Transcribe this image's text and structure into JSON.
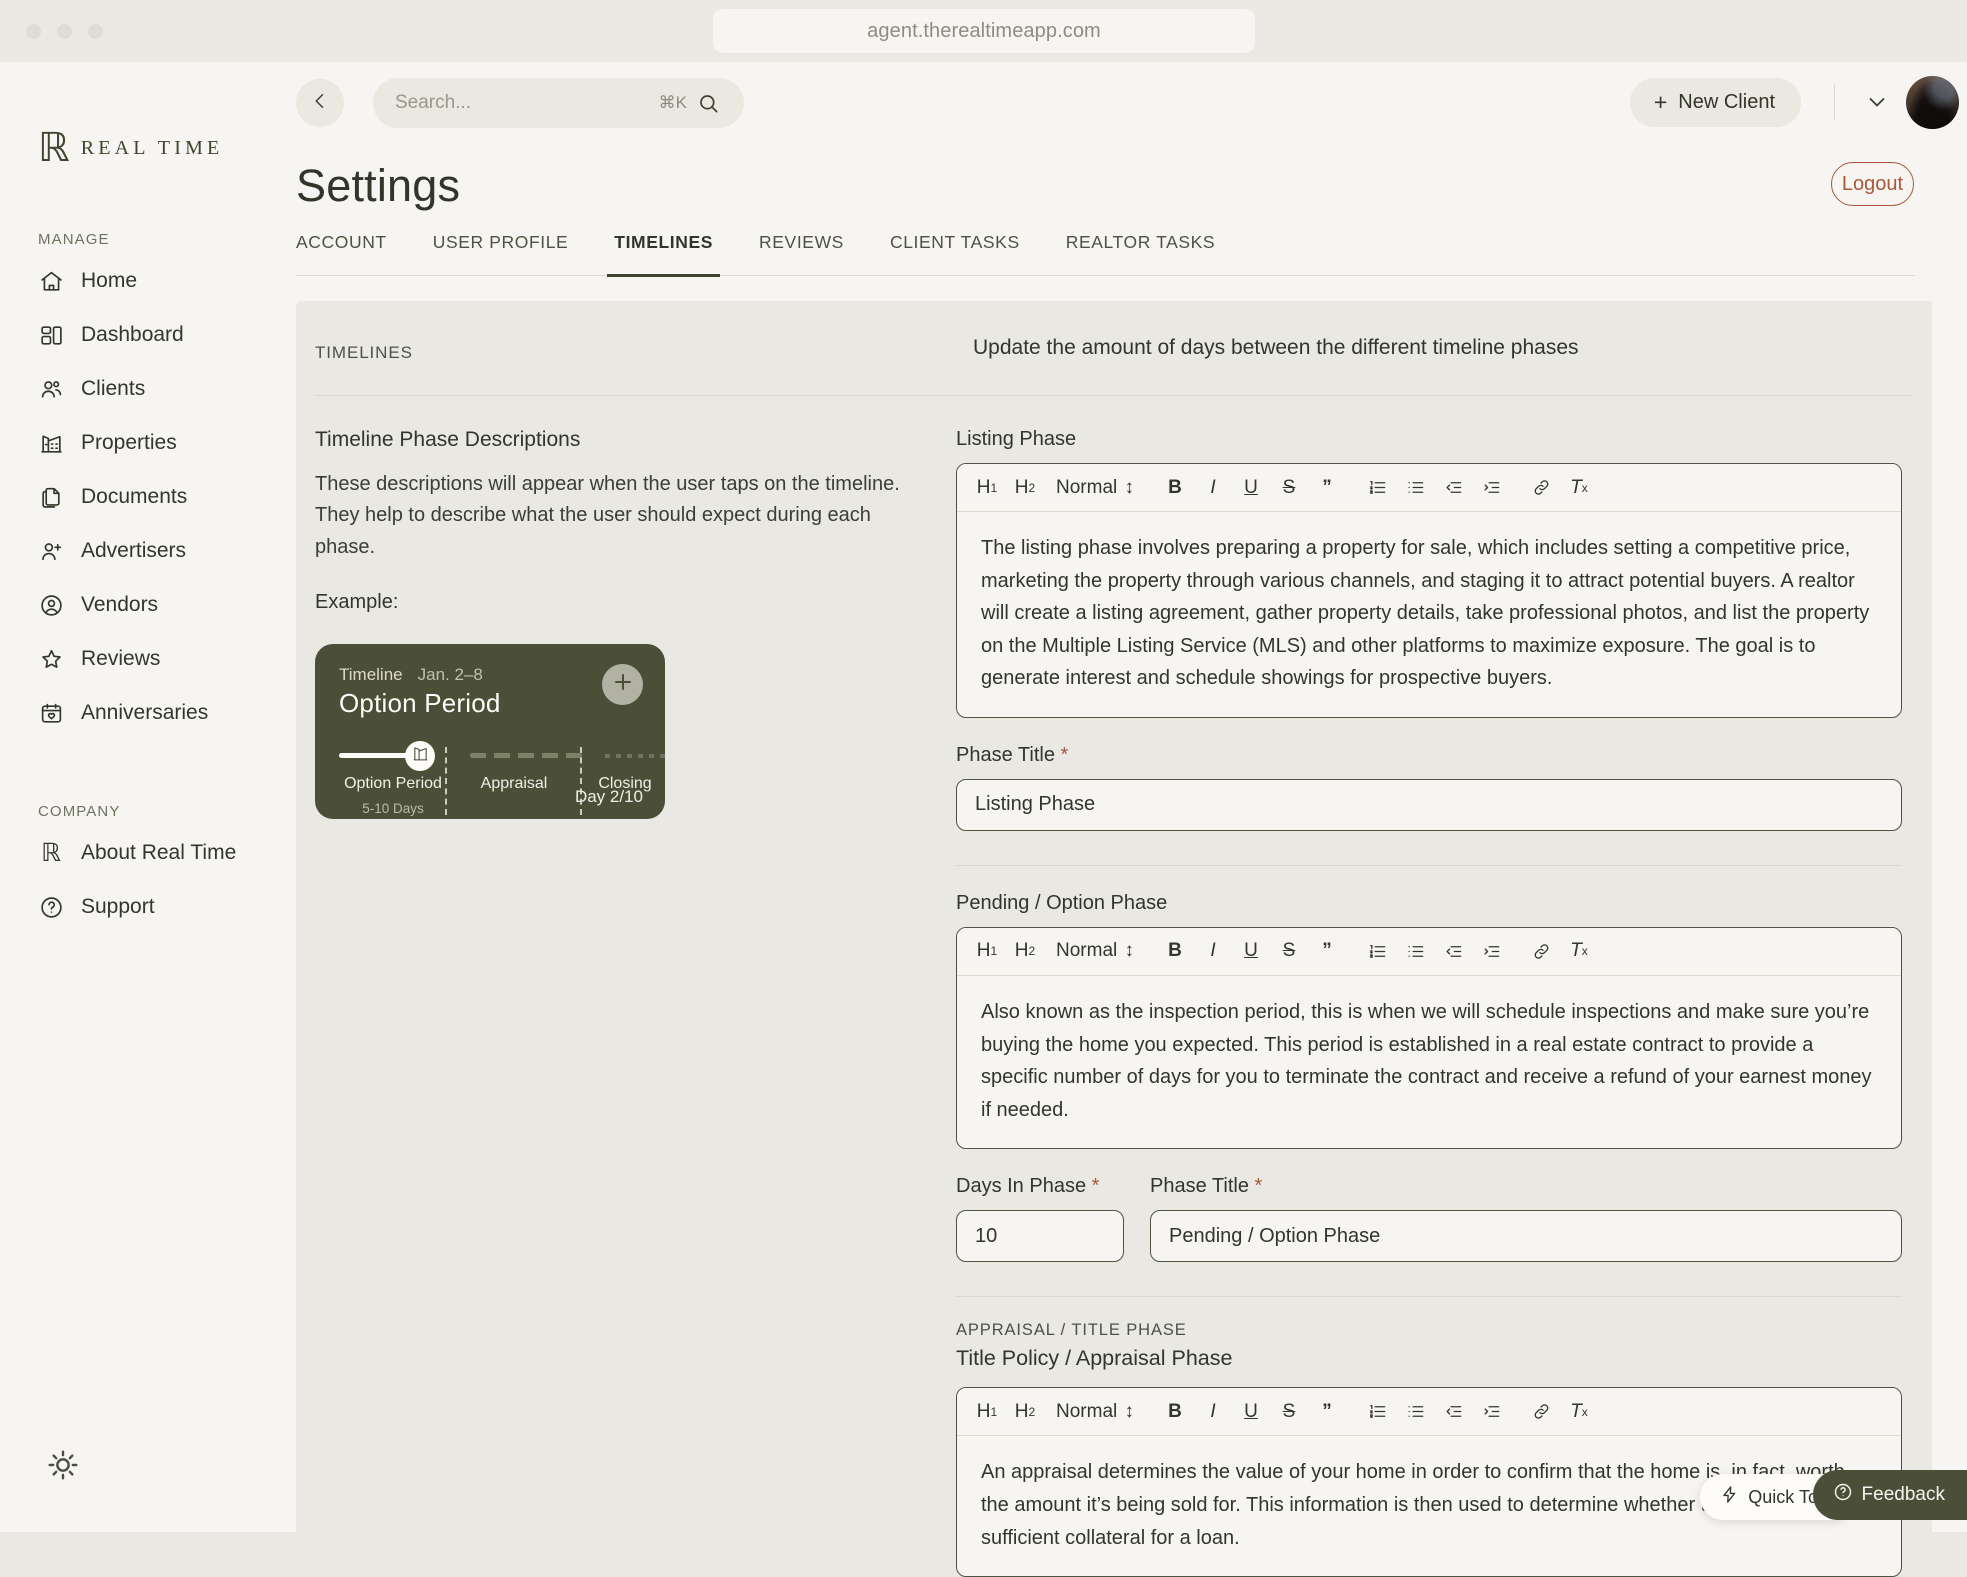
{
  "browser": {
    "url": "agent.therealtimeapp.com"
  },
  "brand": {
    "logo_mark": "ℝ",
    "logo_text": "REAL TIME"
  },
  "sidebar": {
    "sections": [
      {
        "label": "MANAGE",
        "items": [
          {
            "label": "Home",
            "icon": "home-icon"
          },
          {
            "label": "Dashboard",
            "icon": "dashboard-icon"
          },
          {
            "label": "Clients",
            "icon": "users-icon"
          },
          {
            "label": "Properties",
            "icon": "building-icon"
          },
          {
            "label": "Documents",
            "icon": "documents-icon"
          },
          {
            "label": "Advertisers",
            "icon": "user-plus-icon"
          },
          {
            "label": "Vendors",
            "icon": "user-circle-icon"
          },
          {
            "label": "Reviews",
            "icon": "star-icon"
          },
          {
            "label": "Anniversaries",
            "icon": "calendar-heart-icon"
          }
        ]
      },
      {
        "label": "COMPANY",
        "items": [
          {
            "label": "About Real Time",
            "icon": "realtime-logo-icon"
          },
          {
            "label": "Support",
            "icon": "question-circle-icon"
          }
        ]
      }
    ],
    "theme_toggle_icon": "sun-icon"
  },
  "topbar": {
    "back_icon": "chevron-left-icon",
    "search": {
      "placeholder": "Search...",
      "shortcut": "⌘K",
      "icon": "search-icon"
    },
    "new_client": {
      "label": "New Client",
      "icon": "plus-icon"
    },
    "account_chevron_icon": "chevron-down-icon",
    "avatar": "user-avatar"
  },
  "page": {
    "title": "Settings",
    "logout_label": "Logout",
    "tabs": [
      {
        "label": "ACCOUNT",
        "active": false
      },
      {
        "label": "USER PROFILE",
        "active": false
      },
      {
        "label": "TIMELINES",
        "active": true
      },
      {
        "label": "REVIEWS",
        "active": false
      },
      {
        "label": "CLIENT TASKS",
        "active": false
      },
      {
        "label": "REALTOR TASKS",
        "active": false
      }
    ]
  },
  "card": {
    "eyebrow": "TIMELINES",
    "description": "Update the amount of days between the different timeline phases"
  },
  "left_panel": {
    "heading": "Timeline Phase Descriptions",
    "body": "These descriptions will appear when the user taps on the timeline. They help to describe what the user should expect during each phase.",
    "example_label": "Example:",
    "timeline_card": {
      "kicker": "Timeline",
      "date": "Jan. 2–8",
      "title": "Option Period",
      "add_icon": "plus-icon",
      "marker_icon": "property-icon",
      "phases": [
        {
          "label": "Option Period",
          "sub": "5-10 Days"
        },
        {
          "label": "Appraisal",
          "sub": ""
        },
        {
          "label": "Closing",
          "sub": ""
        }
      ],
      "day_counter": "Day 2/10"
    }
  },
  "toolbar": {
    "h1": "H",
    "h1_sub": "1",
    "h2": "H",
    "h2_sub": "2",
    "format_value": "Normal",
    "bold": "B",
    "italic": "I",
    "underline": "U",
    "strike": "S",
    "quote": "”",
    "items": [
      "h1-button",
      "h2-button",
      "format-select",
      "bold-button",
      "italic-button",
      "underline-button",
      "strikethrough-button",
      "blockquote-button",
      "ordered-list-button",
      "bullet-list-button",
      "outdent-button",
      "indent-button",
      "link-button",
      "clear-format-button"
    ]
  },
  "sections": [
    {
      "id": "listing",
      "heading": "Listing Phase",
      "editor_text": "The listing phase involves preparing a property for sale, which includes setting a competitive price, marketing the property through various channels, and staging it to attract potential buyers. A realtor will create a listing agreement, gather property details, take professional photos, and list the property on the Multiple Listing Service (MLS) and other platforms to maximize exposure. The goal is to generate interest and schedule showings for prospective buyers.",
      "phase_title_label": "Phase Title",
      "phase_title_value": "Listing Phase"
    },
    {
      "id": "pending",
      "heading": "Pending / Option Phase",
      "editor_text": "Also known as the inspection period, this is when we will schedule inspections and make sure you’re buying the home you expected. This period is established in a real estate contract to provide a specific number of days for you to terminate the contract and receive a refund of your earnest money if needed.",
      "days_label": "Days In Phase",
      "days_value": "10",
      "phase_title_label": "Phase Title",
      "phase_title_value": "Pending / Option Phase"
    },
    {
      "id": "appraisal",
      "eyebrow": "APPRAISAL / TITLE PHASE",
      "heading": "Title Policy / Appraisal Phase",
      "editor_text": "An appraisal determines the value of your home in order to confirm that the home is, in fact, worth the amount it’s being sold for. This information is then used to determine whether the house is sufficient collateral for a loan."
    }
  ],
  "floating": {
    "quick_tour": {
      "label": "Quick Tour",
      "icon": "bolt-icon"
    },
    "feedback": {
      "label": "Feedback",
      "icon": "question-circle-icon"
    }
  },
  "colors": {
    "accent": "#a8583a",
    "brand_dark": "#4b4f38",
    "page_bg": "#f7f5f1",
    "card_bg": "#e9e8e3"
  }
}
